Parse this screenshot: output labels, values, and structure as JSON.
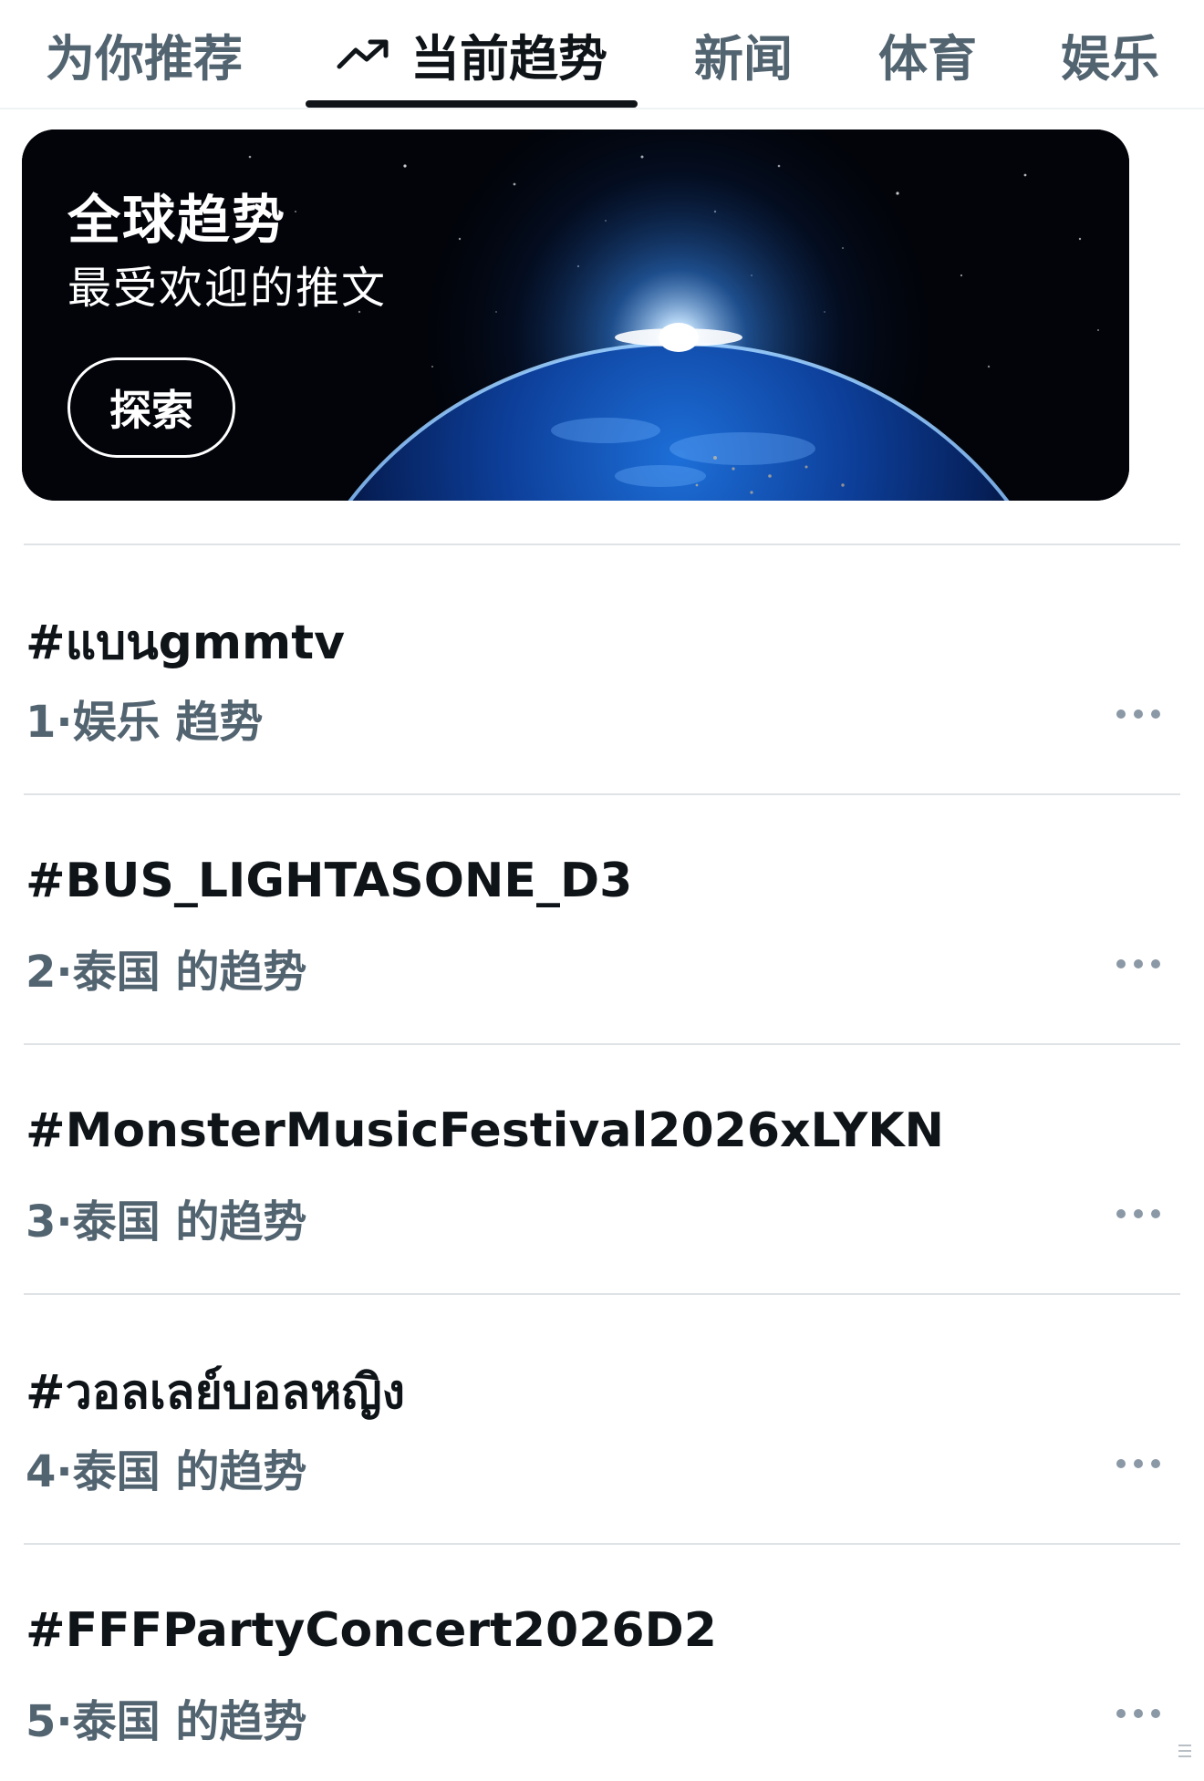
{
  "tabs": [
    {
      "label": "为你推荐",
      "active": false
    },
    {
      "label": "当前趋势",
      "active": true,
      "icon": "trending-arrow-icon"
    },
    {
      "label": "新闻",
      "active": false
    },
    {
      "label": "体育",
      "active": false
    },
    {
      "label": "娱乐",
      "active": false
    }
  ],
  "banner": {
    "title": "全球趋势",
    "subtitle": "最受欢迎的推文",
    "button_label": "探索",
    "image": "earth-from-space-with-sunrise"
  },
  "trends": [
    {
      "name": "#แบนgmmtv",
      "rank": "1",
      "category": "娱乐 趋势"
    },
    {
      "name": "#BUS_LIGHTASONE_D3",
      "rank": "2",
      "category": "泰国 的趋势"
    },
    {
      "name": "#MonsterMusicFestival2026xLYKN",
      "rank": "3",
      "category": "泰国 的趋势"
    },
    {
      "name": "#วอลเลย์บอลหญิง",
      "rank": "4",
      "category": "泰国 的趋势"
    },
    {
      "name": "#FFFPartyConcert2026D2",
      "rank": "5",
      "category": "泰国 的趋势"
    }
  ],
  "colors": {
    "text_primary": "#0f1419",
    "text_secondary": "#536471",
    "divider": "#dfe3e6"
  }
}
